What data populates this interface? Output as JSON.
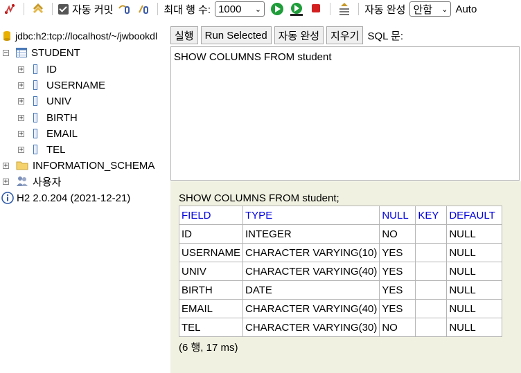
{
  "toolbar": {
    "autocommit_label": "자동 커밋",
    "max_rows_label": "최대 행 수:",
    "max_rows_value": "1000",
    "autocomplete_label": "자동 완성",
    "autocomplete_value": "안함",
    "auto_label": "Auto"
  },
  "connection": {
    "url": "jdbc:h2:tcp://localhost/~/jwbookdl"
  },
  "tree": {
    "table_name": "STUDENT",
    "columns": [
      "ID",
      "USERNAME",
      "UNIV",
      "BIRTH",
      "EMAIL",
      "TEL"
    ],
    "schema": "INFORMATION_SCHEMA",
    "users": "사용자",
    "version": "H2 2.0.204 (2021-12-21)"
  },
  "buttons": {
    "run": "실행",
    "run_selected": "Run Selected",
    "autocomplete": "자동 완성",
    "clear": "지우기",
    "sql_label": "SQL 문:"
  },
  "editor": {
    "sql": "SHOW COLUMNS FROM student"
  },
  "result": {
    "query": "SHOW COLUMNS FROM student;",
    "headers": [
      "FIELD",
      "TYPE",
      "NULL",
      "KEY",
      "DEFAULT"
    ],
    "rows": [
      [
        "ID",
        "INTEGER",
        "NO",
        "",
        "NULL"
      ],
      [
        "USERNAME",
        "CHARACTER VARYING(10)",
        "YES",
        "",
        "NULL"
      ],
      [
        "UNIV",
        "CHARACTER VARYING(40)",
        "YES",
        "",
        "NULL"
      ],
      [
        "BIRTH",
        "DATE",
        "YES",
        "",
        "NULL"
      ],
      [
        "EMAIL",
        "CHARACTER VARYING(40)",
        "YES",
        "",
        "NULL"
      ],
      [
        "TEL",
        "CHARACTER VARYING(30)",
        "NO",
        "",
        "NULL"
      ]
    ],
    "summary": "(6 행, 17 ms)"
  }
}
